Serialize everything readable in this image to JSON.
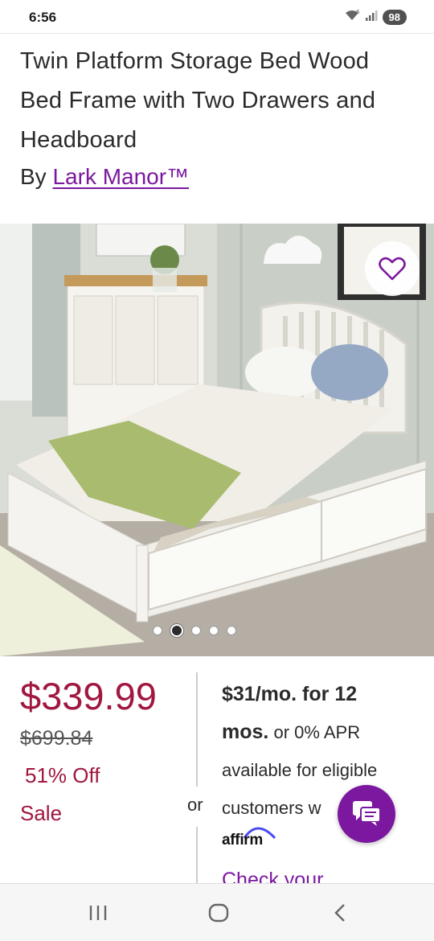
{
  "status_bar": {
    "time": "6:56",
    "battery": "98",
    "icons": [
      "wifi-icon",
      "signal-icon",
      "battery-icon"
    ]
  },
  "product": {
    "title": "Twin Platform Storage Bed Wood Bed Frame with Two Drawers and Headboard",
    "by_prefix": "By",
    "brand": "Lark Manor™",
    "image": {
      "description_icon": "product-photo",
      "carousel_count": 5,
      "carousel_active_index": 1
    },
    "favorite_icon": "heart-icon"
  },
  "pricing": {
    "current": "$339.99",
    "original": "$699.84",
    "discount": "51% Off",
    "badge": "Sale",
    "or_label": "or",
    "financing_bold_1": "$31/mo. for 12",
    "financing_bold_2": "mos.",
    "financing_text_1": " or 0% APR",
    "financing_text_2": "available for eligible",
    "financing_text_3": "customers w",
    "affirm_logo": "affirm",
    "check_link": "Check your"
  },
  "chat": {
    "icon": "chat-icon"
  },
  "nav_bar": {
    "icons": [
      "recent-apps-icon",
      "home-icon",
      "back-icon"
    ]
  },
  "colors": {
    "brand_purple": "#7b189f",
    "price_red": "#a0173f"
  }
}
